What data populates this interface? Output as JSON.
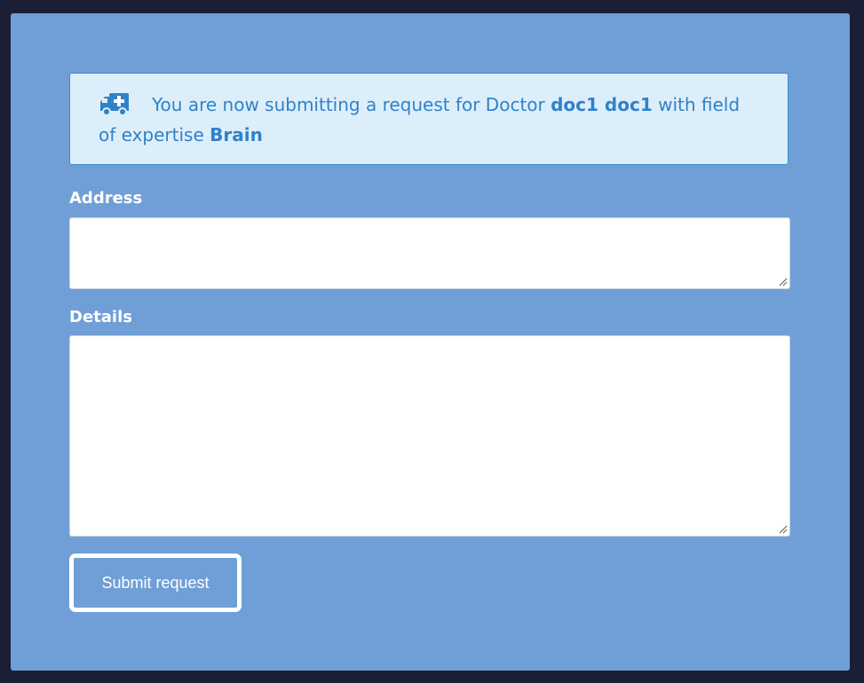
{
  "alert": {
    "icon": "ambulance-icon",
    "text_before": "You are now submitting a request for Doctor ",
    "doctor_name": "doc1 doc1",
    "text_middle": " with field of expertise ",
    "expertise": "Brain"
  },
  "form": {
    "address_label": "Address",
    "address_value": "",
    "details_label": "Details",
    "details_value": "",
    "submit_label": "Submit request"
  },
  "colors": {
    "page_background": "#1b1f36",
    "panel_background": "#6f9fd6",
    "alert_background": "#ddeefb",
    "alert_text": "#2f82c8"
  }
}
